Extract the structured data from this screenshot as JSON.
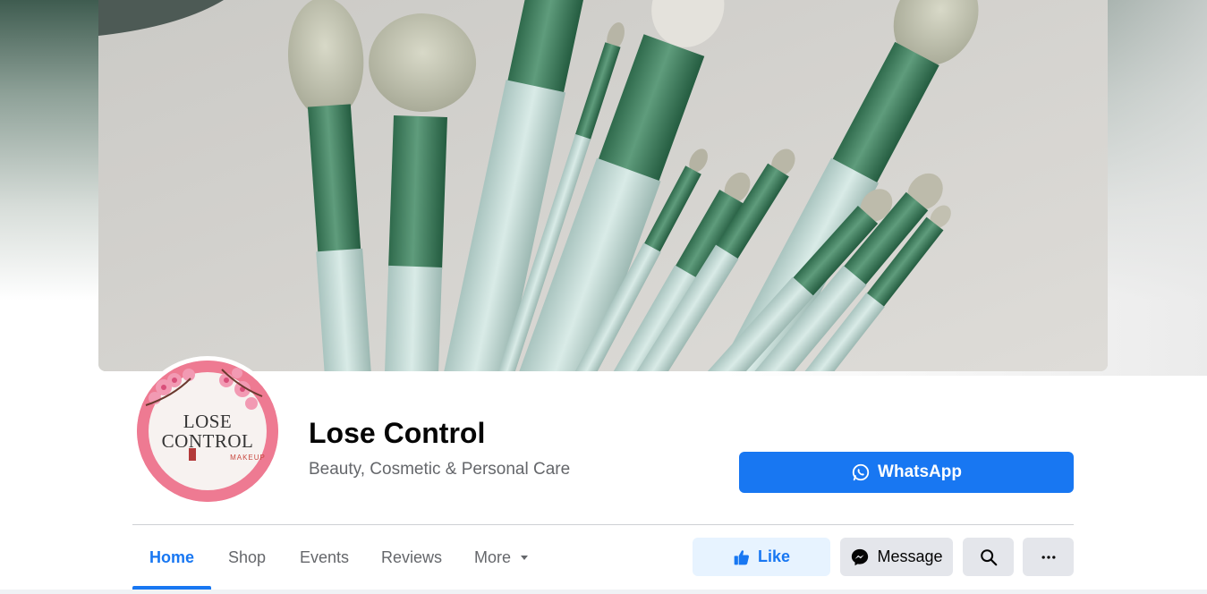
{
  "page": {
    "name": "Lose Control",
    "category": "Beauty, Cosmetic & Personal Care"
  },
  "logo": {
    "line1": "LOSE",
    "line2": "CONTROL",
    "line3": "MAKEUP"
  },
  "cta": {
    "label": "WhatsApp",
    "icon": "whatsapp-icon",
    "color": "#1877f2"
  },
  "tabs": [
    {
      "label": "Home",
      "active": true
    },
    {
      "label": "Shop"
    },
    {
      "label": "Events"
    },
    {
      "label": "Reviews"
    },
    {
      "label": "More",
      "icon": "caret-down-icon"
    }
  ],
  "actions": {
    "like": {
      "label": "Like",
      "icon": "thumbs-up-icon"
    },
    "message": {
      "label": "Message",
      "icon": "messenger-icon"
    },
    "search": {
      "icon": "search-icon"
    },
    "more": {
      "icon": "ellipsis-icon"
    }
  },
  "colors": {
    "accent": "#1877f2",
    "brush_green": "#3f7a5c",
    "brush_handle": "#c9ded9"
  }
}
